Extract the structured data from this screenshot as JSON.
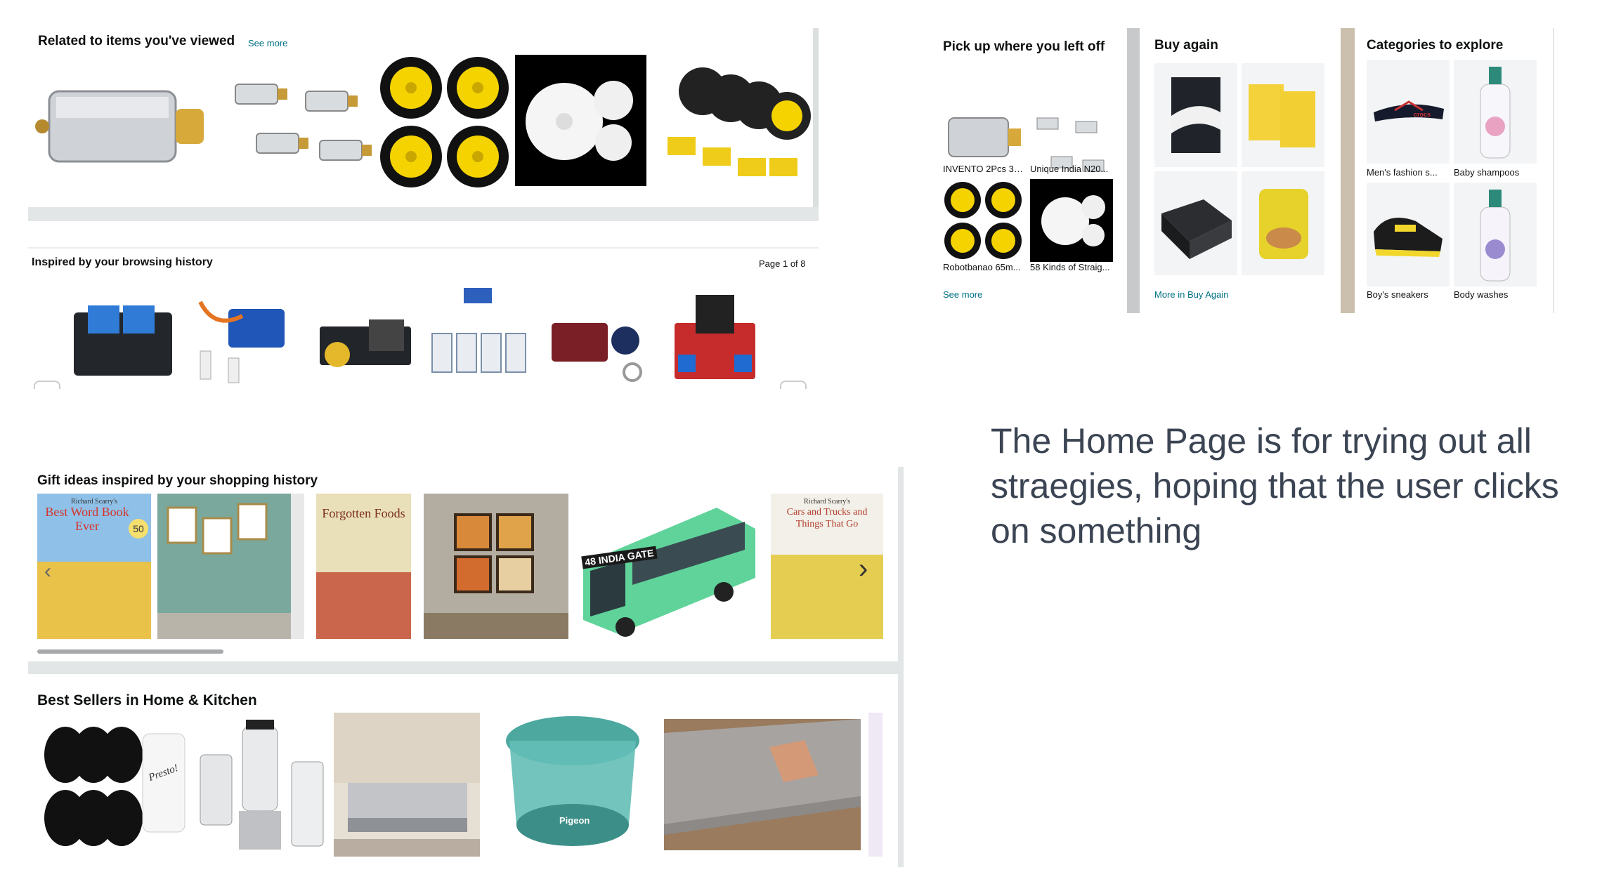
{
  "related": {
    "title": "Related to items you've viewed",
    "see_more": "See more"
  },
  "inspired": {
    "title": "Inspired by your browsing history",
    "page": "Page 1 of 8"
  },
  "gift": {
    "title": "Gift ideas inspired by your shopping history"
  },
  "bestsellers": {
    "title": "Best Sellers in Home & Kitchen"
  },
  "pickup": {
    "title": "Pick up where you left off",
    "items": [
      "INVENTO 2Pcs 3V...",
      "Unique India N20...",
      "Robotbanao 65m...",
      "58 Kinds of Straig..."
    ],
    "see_more": "See more"
  },
  "buyagain": {
    "title": "Buy again",
    "more": "More in Buy Again"
  },
  "categories": {
    "title": "Categories to explore",
    "items": [
      "Men's fashion s...",
      "Baby shampoos",
      "Boy's sneakers",
      "Body washes"
    ]
  },
  "books": {
    "book1_author": "Richard Scarry's",
    "book1_title": "Best Word Book Ever",
    "book1_num": "50",
    "book2_title": "Forgotten Foods",
    "book3_author": "Richard Scarry's",
    "book3_title": "Cars and Trucks and Things That Go",
    "bus_text": "48 INDIA GATE"
  },
  "brand": {
    "presto": "Presto!",
    "slipper": "crocs",
    "pigeon": "Pigeon"
  },
  "tagline": "The Home Page is for trying out all straegies, hoping that the user clicks on something",
  "colors": {
    "link": "#007185",
    "divider": "#e3e6e6",
    "motor_yellow": "#f4d300"
  }
}
